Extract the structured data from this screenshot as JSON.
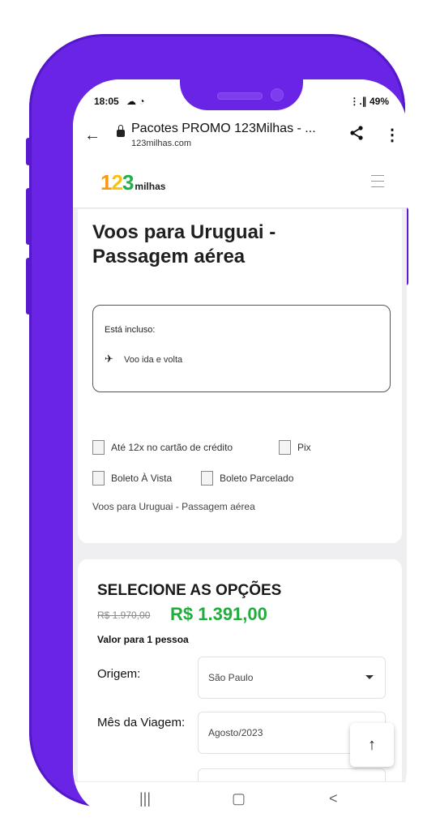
{
  "status_bar": {
    "time": "18:05",
    "left_icons": "☁ ◔",
    "right_text": "⋮.∥ 49%"
  },
  "browser": {
    "back_icon": "arrow-left-icon",
    "page_title": "Pacotes PROMO 123Milhas - ...",
    "domain": "123milhas.com",
    "share_icon": "share-icon",
    "menu_icon": "more-vertical-icon"
  },
  "site": {
    "logo_digits": [
      "1",
      "2",
      "3"
    ],
    "logo_word": "milhas",
    "brand_colors": {
      "one": "#f79a12",
      "two": "#f7c30f",
      "three": "#21b14a"
    }
  },
  "main": {
    "heading": "Voos para Uruguai - Passagem aérea",
    "included_label": "Está incluso:",
    "included_items": [
      "Voo ida e volta"
    ],
    "payment_options": [
      "Até 12x no cartão de crédito",
      "Pix",
      "Boleto À Vista",
      "Boleto Parcelado"
    ],
    "seo_text": "Voos para Uruguai - Passagem aérea"
  },
  "options": {
    "title": "SELECIONE AS OPÇÕES",
    "old_price": "R$ 1.970,00",
    "new_price": "R$ 1.391,00",
    "price_color": "#1fae3c",
    "per_person": "Valor para 1 pessoa",
    "origin_label": "Origem:",
    "origin_value": "São Paulo",
    "month_label": "Mês da Viagem:",
    "month_value": "Agosto/2023"
  },
  "nav": {
    "recents": "|||",
    "home": "▢",
    "back": "<"
  },
  "scroll_top": "↑"
}
